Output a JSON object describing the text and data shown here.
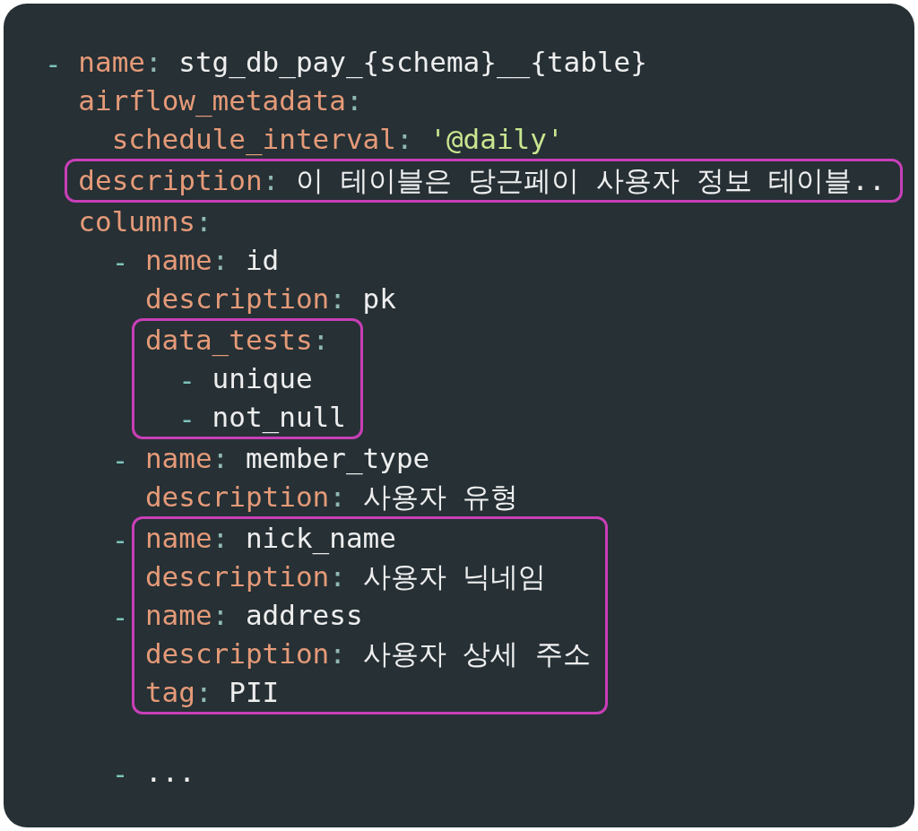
{
  "tree": [
    {
      "kind": "line",
      "bullet": "-",
      "highlighted": false,
      "tokens": [
        {
          "kind": "key",
          "text": "name"
        },
        {
          "kind": "colon",
          "text": ":"
        },
        {
          "kind": "text",
          "text": "stg_db_pay_{schema}__{table}"
        }
      ],
      "children": [
        {
          "kind": "line",
          "highlighted": false,
          "tokens": [
            {
              "kind": "key",
              "text": "airflow_metadata"
            },
            {
              "kind": "colon",
              "text": ":"
            }
          ],
          "children": [
            {
              "kind": "line",
              "highlighted": false,
              "tokens": [
                {
                  "kind": "key",
                  "text": "schedule_interval"
                },
                {
                  "kind": "colon",
                  "text": ":"
                },
                {
                  "kind": "string",
                  "text": "'@daily'"
                }
              ]
            }
          ]
        },
        {
          "kind": "line",
          "highlighted": true,
          "tokens": [
            {
              "kind": "key",
              "text": "description"
            },
            {
              "kind": "colon",
              "text": ":"
            },
            {
              "kind": "text",
              "text": "이 테이블은 당근페이 사용자 정보 테이블.."
            }
          ]
        },
        {
          "kind": "line",
          "highlighted": false,
          "tokens": [
            {
              "kind": "key",
              "text": "columns"
            },
            {
              "kind": "colon",
              "text": ":"
            }
          ],
          "children": [
            {
              "kind": "line",
              "bullet": "-",
              "highlighted": false,
              "tokens": [
                {
                  "kind": "key",
                  "text": "name"
                },
                {
                  "kind": "colon",
                  "text": ":"
                },
                {
                  "kind": "text",
                  "text": "id"
                }
              ],
              "children": [
                {
                  "kind": "line",
                  "highlighted": false,
                  "tokens": [
                    {
                      "kind": "key",
                      "text": "description"
                    },
                    {
                      "kind": "colon",
                      "text": ":"
                    },
                    {
                      "kind": "text",
                      "text": "pk"
                    }
                  ]
                },
                {
                  "kind": "line",
                  "highlighted": true,
                  "tokens": [
                    {
                      "kind": "key",
                      "text": "data_tests"
                    },
                    {
                      "kind": "colon",
                      "text": ":"
                    }
                  ],
                  "children": [
                    {
                      "kind": "line",
                      "bullet": "-",
                      "highlighted": false,
                      "tokens": [
                        {
                          "kind": "text",
                          "text": "unique"
                        }
                      ]
                    },
                    {
                      "kind": "line",
                      "bullet": "-",
                      "highlighted": false,
                      "tokens": [
                        {
                          "kind": "text",
                          "text": "not_null"
                        }
                      ]
                    }
                  ]
                }
              ]
            },
            {
              "kind": "line",
              "bullet": "-",
              "highlighted": false,
              "tokens": [
                {
                  "kind": "key",
                  "text": "name"
                },
                {
                  "kind": "colon",
                  "text": ":"
                },
                {
                  "kind": "text",
                  "text": "member_type"
                }
              ],
              "children": [
                {
                  "kind": "line",
                  "highlighted": false,
                  "tokens": [
                    {
                      "kind": "key",
                      "text": "description"
                    },
                    {
                      "kind": "colon",
                      "text": ":"
                    },
                    {
                      "kind": "text",
                      "text": "사용자 유형"
                    }
                  ]
                }
              ]
            },
            {
              "kind": "line",
              "bullet": "-",
              "highlighted": true,
              "tokens": [
                {
                  "kind": "key",
                  "text": "name"
                },
                {
                  "kind": "colon",
                  "text": ":"
                },
                {
                  "kind": "text",
                  "text": "nick_name"
                }
              ],
              "children": [
                {
                  "kind": "line",
                  "highlighted": false,
                  "tokens": [
                    {
                      "kind": "key",
                      "text": "description"
                    },
                    {
                      "kind": "colon",
                      "text": ":"
                    },
                    {
                      "kind": "text",
                      "text": "사용자 닉네임"
                    }
                  ]
                }
              ]
            },
            {
              "kind": "line",
              "bullet": "-",
              "highlighted": true,
              "tokens": [
                {
                  "kind": "key",
                  "text": "name"
                },
                {
                  "kind": "colon",
                  "text": ":"
                },
                {
                  "kind": "text",
                  "text": "address"
                }
              ],
              "children": [
                {
                  "kind": "line",
                  "highlighted": false,
                  "tokens": [
                    {
                      "kind": "key",
                      "text": "description"
                    },
                    {
                      "kind": "colon",
                      "text": ":"
                    },
                    {
                      "kind": "text",
                      "text": "사용자 상세 주소"
                    }
                  ]
                },
                {
                  "kind": "line",
                  "highlighted": false,
                  "tokens": [
                    {
                      "kind": "key",
                      "text": "tag"
                    },
                    {
                      "kind": "colon",
                      "text": ":"
                    },
                    {
                      "kind": "text",
                      "text": "PII"
                    }
                  ]
                }
              ]
            },
            {
              "kind": "spacer"
            },
            {
              "kind": "line",
              "bullet": "-",
              "highlighted": false,
              "tokens": [
                {
                  "kind": "text",
                  "text": "..."
                }
              ]
            }
          ]
        }
      ]
    }
  ]
}
